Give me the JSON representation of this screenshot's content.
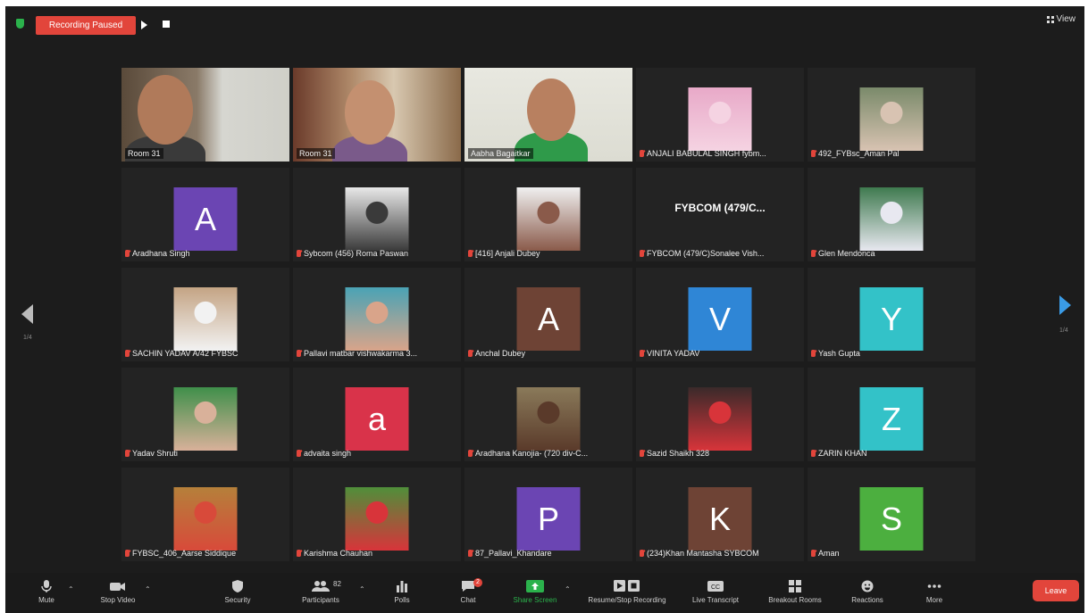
{
  "topbar": {
    "recording_badge": "Recording Paused",
    "view_label": "View"
  },
  "pagination": {
    "left": "1/4",
    "right": "1/4"
  },
  "participants": [
    {
      "name": "Room 31",
      "kind": "video"
    },
    {
      "name": "Room 31",
      "kind": "video"
    },
    {
      "name": "Aabha Bagaitkar",
      "kind": "video"
    },
    {
      "name": "ANJALI BABULAL SINGH fybm...",
      "kind": "photo",
      "photo_color": "#e8a9c8",
      "photo_accent": "#f5d3e2"
    },
    {
      "name": "492_FYBsc_Aman Pal",
      "kind": "photo",
      "photo_color": "#7a8a6a",
      "photo_accent": "#d8c3b2"
    },
    {
      "name": "Aradhana Singh",
      "kind": "avatar",
      "letter": "A",
      "color": "#6b45b3"
    },
    {
      "name": "Sybcom (456) Roma Paswan",
      "kind": "photo",
      "photo_color": "#e8e8e8",
      "photo_accent": "#3a3a3a"
    },
    {
      "name": "[416] Anjali Dubey",
      "kind": "photo",
      "photo_color": "#f0f0f0",
      "photo_accent": "#8a5a4a"
    },
    {
      "name": "FYBCOM (479/C)Sonalee Vish...",
      "kind": "text",
      "text": "FYBCOM (479/C..."
    },
    {
      "name": "Glen Mendonca",
      "kind": "photo",
      "photo_color": "#3f7a4f",
      "photo_accent": "#e8e8f0"
    },
    {
      "name": "SACHIN YADAV A/42 FYBSC",
      "kind": "photo",
      "photo_color": "#c4a484",
      "photo_accent": "#f2f2f2"
    },
    {
      "name": "Pallavi matbar vishwakarma 3...",
      "kind": "photo",
      "photo_color": "#4aa3b5",
      "photo_accent": "#d9a48a"
    },
    {
      "name": "Anchal Dubey",
      "kind": "avatar",
      "letter": "A",
      "color": "#6e4335"
    },
    {
      "name": "VINITA YADAV",
      "kind": "avatar",
      "letter": "V",
      "color": "#2f86d6"
    },
    {
      "name": "Yash Gupta",
      "kind": "avatar",
      "letter": "Y",
      "color": "#33c2c8"
    },
    {
      "name": "Yadav Shruti",
      "kind": "photo",
      "photo_color": "#3f8f4a",
      "photo_accent": "#d9b19a"
    },
    {
      "name": "advaita singh",
      "kind": "avatar",
      "letter": "a",
      "color": "#d9334a"
    },
    {
      "name": "Aradhana Kanojia- (720 div-C...",
      "kind": "photo",
      "photo_color": "#8a7a5a",
      "photo_accent": "#5a3a2a"
    },
    {
      "name": "Sazid Shaikh 328",
      "kind": "photo",
      "photo_color": "#3a2a2a",
      "photo_accent": "#d8343a"
    },
    {
      "name": "ZARIN KHAN",
      "kind": "avatar",
      "letter": "Z",
      "color": "#33c2c8"
    },
    {
      "name": "FYBSC_406_Aarse Siddique",
      "kind": "photo",
      "photo_color": "#b5803a",
      "photo_accent": "#d84a3a"
    },
    {
      "name": "Karishma Chauhan",
      "kind": "photo",
      "photo_color": "#4f8f3a",
      "photo_accent": "#d8343a"
    },
    {
      "name": "87_Pallavi_Khandare",
      "kind": "avatar",
      "letter": "P",
      "color": "#6b45b3"
    },
    {
      "name": "(234)Khan Mantasha SYBCOM",
      "kind": "avatar",
      "letter": "K",
      "color": "#6e4335"
    },
    {
      "name": "Aman",
      "kind": "avatar",
      "letter": "S",
      "color": "#4caf3f"
    }
  ],
  "toolbar": {
    "mute": "Mute",
    "stop_video": "Stop Video",
    "security": "Security",
    "participants": "Participants",
    "participants_count": "82",
    "polls": "Polls",
    "chat": "Chat",
    "chat_badge": "2",
    "share_screen": "Share Screen",
    "recording": "Resume/Stop Recording",
    "live_transcript": "Live Transcript",
    "breakout_rooms": "Breakout Rooms",
    "reactions": "Reactions",
    "more": "More",
    "leave": "Leave"
  },
  "colors": {
    "accent_red": "#e2453b",
    "share_green": "#2bb24c",
    "active_border": "#b5e61d",
    "nav_arrow": "#3a9be6"
  }
}
